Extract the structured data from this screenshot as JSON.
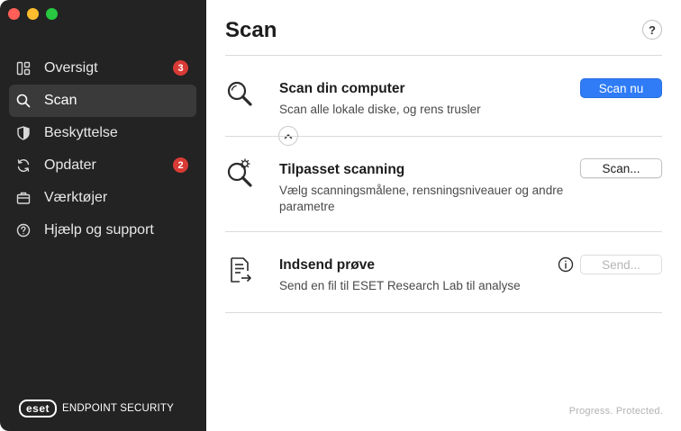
{
  "window": {
    "traffic_lights": {
      "close": "#ff5f57",
      "minimize": "#febc2e",
      "maximize": "#28c840"
    }
  },
  "sidebar": {
    "items": [
      {
        "label": "Oversigt",
        "icon": "dashboard-icon",
        "badge": "3"
      },
      {
        "label": "Scan",
        "icon": "search-icon",
        "active": true
      },
      {
        "label": "Beskyttelse",
        "icon": "shield-icon"
      },
      {
        "label": "Opdater",
        "icon": "refresh-icon",
        "badge": "2"
      },
      {
        "label": "Værktøjer",
        "icon": "briefcase-icon"
      },
      {
        "label": "Hjælp og support",
        "icon": "help-circle-icon"
      }
    ],
    "brand": {
      "logo": "eset",
      "product": "ENDPOINT SECURITY"
    }
  },
  "main": {
    "title": "Scan",
    "help_label": "?",
    "sections": [
      {
        "title": "Scan din computer",
        "description": "Scan alle lokale diske, og rens trusler",
        "button": "Scan nu",
        "icon": "magnifier-icon"
      },
      {
        "title": "Tilpasset scanning",
        "description": "Vælg scanningsmålene, rensningsniveauer og andre parametre",
        "button": "Scan...",
        "icon": "magnifier-gear-icon"
      },
      {
        "title": "Indsend prøve",
        "description": "Send en fil til ESET Research Lab til analyse",
        "button": "Send...",
        "icon": "document-send-icon"
      }
    ],
    "tagline": "Progress. Protected."
  },
  "colors": {
    "sidebar_bg": "#232323",
    "sidebar_active": "#3a3a3a",
    "badge": "#d83a35",
    "primary_button": "#2f7cf6"
  }
}
